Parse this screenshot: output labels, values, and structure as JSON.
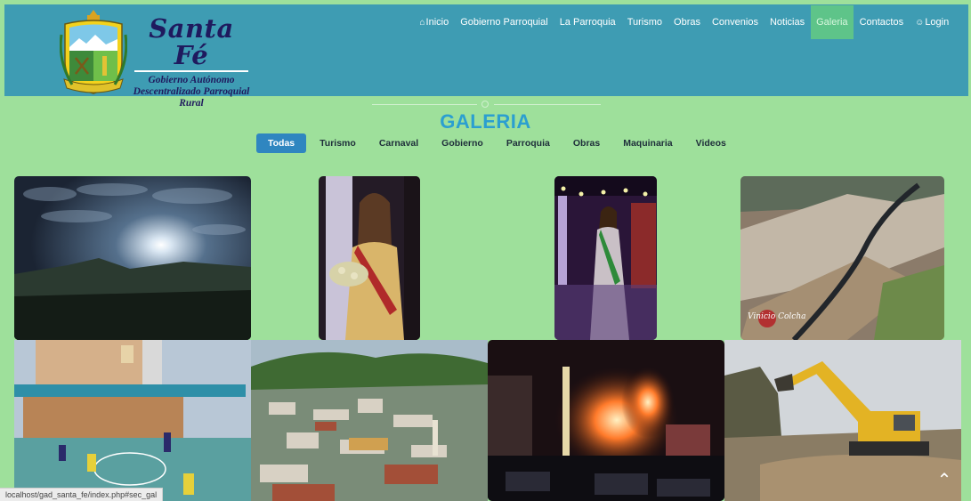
{
  "brand": {
    "title": "Santa Fé",
    "subtitle_lines": [
      "Gobierno Autónomo",
      "Descentralizado Parroquial",
      "Rural"
    ]
  },
  "nav": {
    "items": [
      {
        "label": "Inicio",
        "icon": "home-icon"
      },
      {
        "label": "Gobierno Parroquial"
      },
      {
        "label": "La Parroquia"
      },
      {
        "label": "Turismo"
      },
      {
        "label": "Obras"
      },
      {
        "label": "Convenios"
      },
      {
        "label": "Noticias"
      },
      {
        "label": "Galeria",
        "active": true
      },
      {
        "label": "Contactos"
      },
      {
        "label": "Login",
        "icon": "user-icon"
      }
    ]
  },
  "gallery": {
    "title": "GALERIA",
    "filters": [
      "Todas",
      "Turismo",
      "Carnaval",
      "Gobierno",
      "Parroquia",
      "Obras",
      "Maquinaria",
      "Videos"
    ],
    "active_filter": "Todas",
    "photos": [
      {
        "subject": "night-sky-moon"
      },
      {
        "subject": "queen-sash-flowers"
      },
      {
        "subject": "queen-on-stage"
      },
      {
        "subject": "aerial-road-fields",
        "watermark": "Vinicio Colcha"
      },
      {
        "subject": "church-soccer-court"
      },
      {
        "subject": "town-aerial-view"
      },
      {
        "subject": "night-fireworks"
      },
      {
        "subject": "excavator-earthworks"
      }
    ]
  },
  "status_bar": {
    "text": "localhost/gad_santa_fe/index.php#sec_gal"
  },
  "colors": {
    "page_bg": "#9ee09b",
    "navbar": "#3e9cb3",
    "title": "#2b9fd0",
    "active_filter": "#2f86c0",
    "active_nav": "#5ec489"
  }
}
